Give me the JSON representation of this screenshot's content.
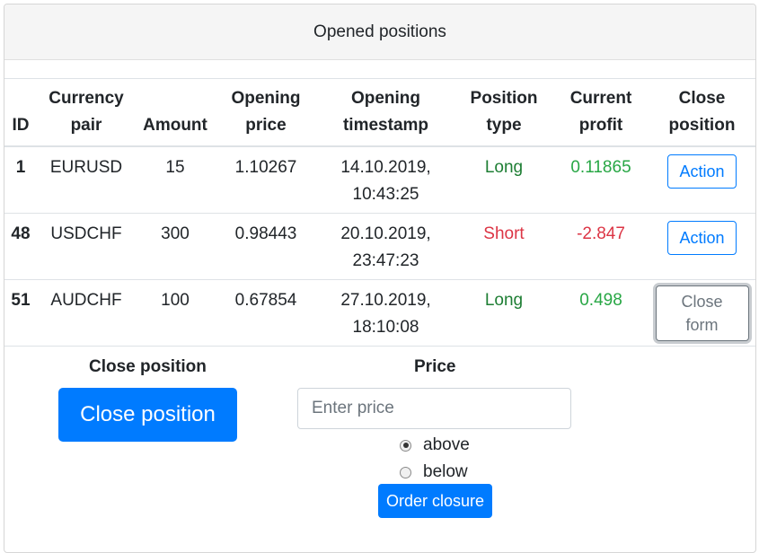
{
  "header": {
    "title": "Opened positions"
  },
  "table": {
    "columns": [
      {
        "line1": "",
        "line2": "ID"
      },
      {
        "line1": "Currency",
        "line2": "pair"
      },
      {
        "line1": "",
        "line2": "Amount"
      },
      {
        "line1": "Opening",
        "line2": "price"
      },
      {
        "line1": "Opening",
        "line2": "timestamp"
      },
      {
        "line1": "Position",
        "line2": "type"
      },
      {
        "line1": "Current",
        "line2": "profit"
      },
      {
        "line1": "Close",
        "line2": "position"
      }
    ],
    "rows": [
      {
        "id": "1",
        "pair": "EURUSD",
        "amount": "15",
        "price": "1.10267",
        "date": "14.10.2019,",
        "time": "10:43:25",
        "type": "Long",
        "profit": "0.11865",
        "action": "Action"
      },
      {
        "id": "48",
        "pair": "USDCHF",
        "amount": "300",
        "price": "0.98443",
        "date": "20.10.2019,",
        "time": "23:47:23",
        "type": "Short",
        "profit": "-2.847",
        "action": "Action"
      },
      {
        "id": "51",
        "pair": "AUDCHF",
        "amount": "100",
        "price": "0.67854",
        "date": "27.10.2019,",
        "time": "18:10:08",
        "type": "Long",
        "profit": "0.498",
        "action_line1": "Close",
        "action_line2": "form"
      }
    ]
  },
  "close_form": {
    "close_label": "Close position",
    "close_button": "Close position",
    "price_label": "Price",
    "price_placeholder": "Enter price",
    "price_value": "",
    "radio_above": "above",
    "radio_below": "below",
    "selected": "above",
    "order_button": "Order closure"
  },
  "colors": {
    "accent": "#007bff",
    "long": "#1e7e34",
    "short": "#dc3545"
  }
}
